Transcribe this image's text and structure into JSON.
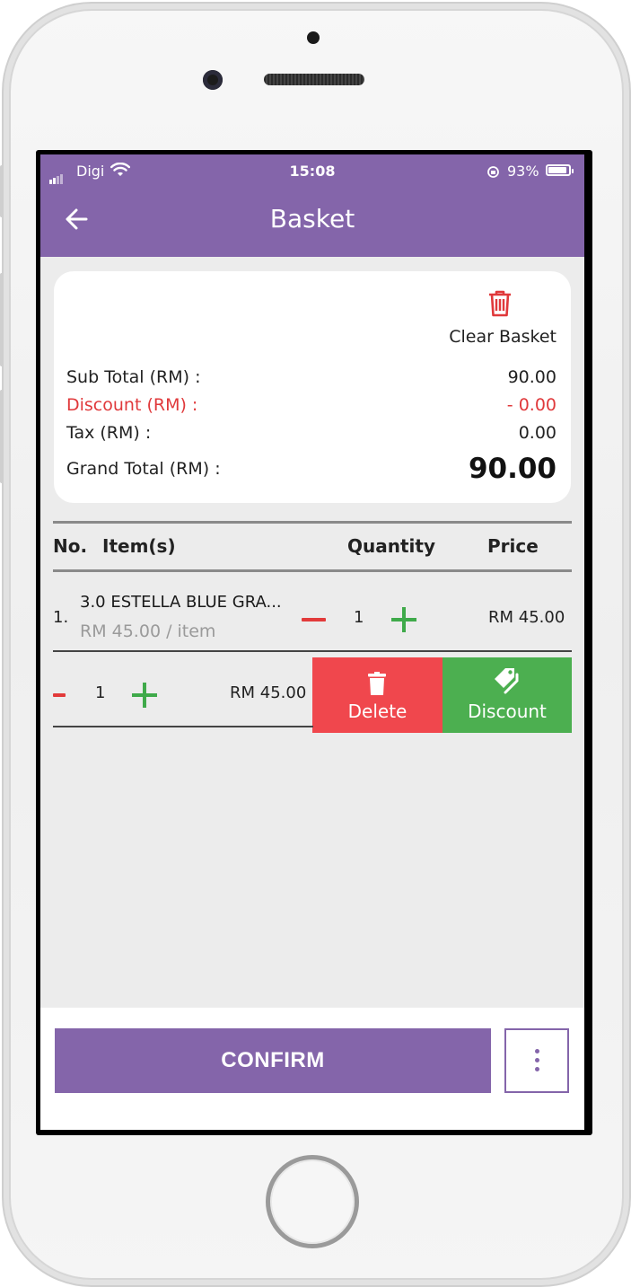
{
  "status_bar": {
    "carrier": "Digi",
    "time": "15:08",
    "battery_text": "93%",
    "battery_level": 0.93
  },
  "header": {
    "title": "Basket",
    "back_icon": "arrow-left-icon"
  },
  "summary": {
    "clear_label": "Clear Basket",
    "clear_icon": "trash-icon",
    "subtotal_label": "Sub Total (RM) :",
    "subtotal_value": "90.00",
    "discount_label": "Discount (RM) :",
    "discount_value": "- 0.00",
    "tax_label": "Tax (RM) :",
    "tax_value": "0.00",
    "grand_label": "Grand Total (RM) :",
    "grand_value": "90.00"
  },
  "table": {
    "headers": {
      "no": "No.",
      "items": "Item(s)",
      "quantity": "Quantity",
      "price": "Price"
    },
    "rows": [
      {
        "no": "1.",
        "name": "3.0 ESTELLA BLUE GRA...",
        "unit": "RM 45.00 / item",
        "qty": "1",
        "price": "RM 45.00"
      },
      {
        "qty": "1",
        "price": "RM 45.00"
      }
    ]
  },
  "swipe_actions": {
    "delete_label": "Delete",
    "discount_label": "Discount",
    "delete_color": "#f0474d",
    "discount_color": "#4caf50"
  },
  "footer": {
    "confirm_label": "CONFIRM",
    "more_icon": "more-vertical-icon"
  },
  "colors": {
    "brand": "#8465aa",
    "danger": "#e0393b",
    "success": "#3faa4a"
  }
}
